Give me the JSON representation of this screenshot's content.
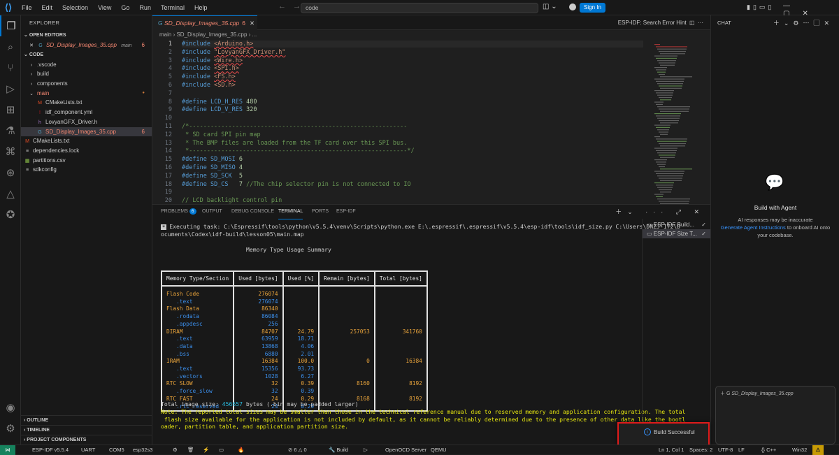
{
  "titlebar": {
    "menu": [
      "File",
      "Edit",
      "Selection",
      "View",
      "Go",
      "Run",
      "Terminal",
      "Help"
    ],
    "command_center": "code",
    "sign_in": "Sign In"
  },
  "sidebar": {
    "title": "EXPLORER",
    "open_editors_label": "OPEN EDITORS",
    "open_editor": {
      "name": "SD_Display_Images_35.cpp",
      "folder": "main",
      "count": "6"
    },
    "root_label": "CODE",
    "tree": [
      {
        "name": ".vscode",
        "kind": "folder",
        "icon": "›"
      },
      {
        "name": "build",
        "kind": "folder",
        "icon": "›"
      },
      {
        "name": "components",
        "kind": "folder",
        "icon": "›"
      },
      {
        "name": "main",
        "kind": "folder-open",
        "icon": "⌄"
      },
      {
        "name": "CMakeLists.txt",
        "kind": "file",
        "icon": "M"
      },
      {
        "name": "idf_component.yml",
        "kind": "file",
        "icon": "!"
      },
      {
        "name": "LovyanGFX_Driver.h",
        "kind": "file",
        "icon": "h"
      },
      {
        "name": "SD_Display_Images_35.cpp",
        "kind": "file",
        "icon": "G",
        "count": "6"
      },
      {
        "name": "CMakeLists.txt",
        "kind": "file",
        "icon": "M"
      },
      {
        "name": "dependencies.lock",
        "kind": "file",
        "icon": "≡"
      },
      {
        "name": "partitions.csv",
        "kind": "file",
        "icon": "▦"
      },
      {
        "name": "sdkconfig",
        "kind": "file",
        "icon": "≡"
      }
    ],
    "bottom_sections": [
      "OUTLINE",
      "TIMELINE",
      "PROJECT COMPONENTS"
    ]
  },
  "editor": {
    "tab_label": "SD_Display_Images_35.cpp",
    "tab_count": "6",
    "tab_right": "ESP-IDF: Search Error Hint",
    "breadcrumb": "main  ›  SD_Display_Images_35.cpp  ›  ...",
    "lines": [
      {
        "n": "1",
        "html": "<span class='kw'>#include</span> <span class='inc wav'>&lt;Arduino.h&gt;</span>"
      },
      {
        "n": "2",
        "html": "<span class='kw'>#include</span> <span class='inc wav'>\"LovyanGFX_Driver.h\"</span>"
      },
      {
        "n": "3",
        "html": "<span class='kw'>#include</span> <span class='inc wav'>&lt;Wire.h&gt;</span>"
      },
      {
        "n": "4",
        "html": "<span class='kw'>#include</span> <span class='inc wav'>&lt;SPI.h&gt;</span>"
      },
      {
        "n": "5",
        "html": "<span class='kw'>#include</span> <span class='inc wav'>&lt;FS.h&gt;</span>"
      },
      {
        "n": "6",
        "html": "<span class='kw'>#include</span> <span class='inc'>&lt;SD.h&gt;</span>"
      },
      {
        "n": "7",
        "html": ""
      },
      {
        "n": "8",
        "html": "<span class='kw'>#define</span> <span class='mac'>LCD_H_RES</span> <span class='num'>480</span>"
      },
      {
        "n": "9",
        "html": "<span class='kw'>#define</span> <span class='mac'>LCD_V_RES</span> <span class='num'>320</span>"
      },
      {
        "n": "10",
        "html": ""
      },
      {
        "n": "11",
        "html": "<span class='cm'>/*-------------------------------------------------------------</span>"
      },
      {
        "n": "12",
        "html": "<span class='cm'> * SD card SPI pin map</span>"
      },
      {
        "n": "13",
        "html": "<span class='cm'> * The BMP files are loaded from the TF card over this SPI bus.</span>"
      },
      {
        "n": "14",
        "html": "<span class='cm'> *-------------------------------------------------------------*/</span>"
      },
      {
        "n": "15",
        "html": "<span class='kw'>#define</span> <span class='mac'>SD_MOSI</span> <span class='num'>6</span>"
      },
      {
        "n": "16",
        "html": "<span class='kw'>#define</span> <span class='mac'>SD_MISO</span> <span class='num'>4</span>"
      },
      {
        "n": "17",
        "html": "<span class='kw'>#define</span> <span class='mac'>SD_SCK</span>  <span class='num'>5</span>"
      },
      {
        "n": "18",
        "html": "<span class='kw'>#define</span> <span class='mac'>SD_CS</span>   <span class='num'>7</span> <span class='cm'>//The chip selector pin is not connected to IO</span>"
      },
      {
        "n": "19",
        "html": ""
      },
      {
        "n": "20",
        "html": "<span class='cm'>// LCD backlight control pin</span>"
      }
    ]
  },
  "panel": {
    "tabs": [
      {
        "label": "PROBLEMS",
        "badge": "6"
      },
      {
        "label": "OUTPUT"
      },
      {
        "label": "DEBUG CONSOLE"
      },
      {
        "label": "TERMINAL",
        "active": true
      },
      {
        "label": "PORTS"
      },
      {
        "label": "ESP-IDF"
      }
    ],
    "terminal": {
      "task_line1": "Executing task: C:\\Espressif\\tools\\python\\v5.5.4\\venv\\Scripts\\python.exe E:\\.espressif\\.espressif\\v5.5.4\\esp-idf\\tools\\idf_size.py C:\\Users\\DNZJ-172\\D",
      "task_line2": "ocuments\\Codex\\idf-build\\lesson05\\main.map",
      "table_title": "Memory Type Usage Summary",
      "headers": [
        "Memory Type/Section",
        "Used [bytes]",
        "Used [%]",
        "Remain [bytes]",
        "Total [bytes]"
      ],
      "rows": [
        {
          "name": "Flash Code",
          "used": "276074",
          "pct": "",
          "remain": "",
          "total": "",
          "sub": false
        },
        {
          "name": "   .text",
          "used": "276074",
          "pct": "",
          "remain": "",
          "total": "",
          "sub": true
        },
        {
          "name": "Flash Data",
          "used": "86340",
          "pct": "",
          "remain": "",
          "total": "",
          "sub": false
        },
        {
          "name": "   .rodata",
          "used": "86084",
          "pct": "",
          "remain": "",
          "total": "",
          "sub": true
        },
        {
          "name": "   .appdesc",
          "used": "256",
          "pct": "",
          "remain": "",
          "total": "",
          "sub": true
        },
        {
          "name": "DIRAM",
          "used": "84707",
          "pct": "24.79",
          "remain": "257053",
          "total": "341760",
          "sub": false
        },
        {
          "name": "   .text",
          "used": "63959",
          "pct": "18.71",
          "remain": "",
          "total": "",
          "sub": true
        },
        {
          "name": "   .data",
          "used": "13868",
          "pct": "4.06",
          "remain": "",
          "total": "",
          "sub": true
        },
        {
          "name": "   .bss",
          "used": "6880",
          "pct": "2.01",
          "remain": "",
          "total": "",
          "sub": true
        },
        {
          "name": "IRAM",
          "used": "16384",
          "pct": "100.0",
          "remain": "0",
          "total": "16384",
          "sub": false
        },
        {
          "name": "   .text",
          "used": "15356",
          "pct": "93.73",
          "remain": "",
          "total": "",
          "sub": true
        },
        {
          "name": "   .vectors",
          "used": "1028",
          "pct": "6.27",
          "remain": "",
          "total": "",
          "sub": true
        },
        {
          "name": "RTC SLOW",
          "used": "32",
          "pct": "0.39",
          "remain": "8160",
          "total": "8192",
          "sub": false
        },
        {
          "name": "   .force_slow",
          "used": "32",
          "pct": "0.39",
          "remain": "",
          "total": "",
          "sub": true
        },
        {
          "name": "RTC FAST",
          "used": "24",
          "pct": "0.29",
          "remain": "8168",
          "total": "8192",
          "sub": false
        },
        {
          "name": "   .rtc_reserved",
          "used": "24",
          "pct": "0.29",
          "remain": "",
          "total": "",
          "sub": true
        }
      ],
      "total_prefix": "Total image size: ",
      "total_value": "456657",
      "total_suffix": " bytes (.bin may be padded larger)",
      "note_lines": [
        "Note: The reported total sizes may be smaller than those in the technical reference manual due to reserved memory and application configuration. The total",
        " flash size available for the application is not included by default, as it cannot be reliably determined due to the presence of other data like the bootl",
        "oader, partition table, and application partition size."
      ]
    },
    "terminal_list": [
      "ESP-IDF Build...",
      "ESP-IDF Size T..."
    ]
  },
  "chat": {
    "title": "CHAT",
    "agent_title": "Build with Agent",
    "agent_desc_1": "AI responses may be inaccurate",
    "agent_link": "Generate Agent Instructions",
    "agent_desc_2": " to onboard AI onto your codebase.",
    "context_file": "SD_Display_Images_35.cpp"
  },
  "toast": {
    "message": "Build Successful"
  },
  "statusbar": {
    "left": [
      "ESP-IDF v5.5.4",
      "UART",
      "COM5",
      "esp32s3",
      "⚙",
      "🗑",
      "⚡",
      "▭",
      "🔥",
      "⊘ 6 △ 0",
      "🔧 Build",
      "▷",
      "OpenOCD Server",
      "QEMU"
    ],
    "right": [
      "Ln 1, Col 1",
      "Spaces: 2",
      "UTF-8",
      "LF",
      "{} C++",
      "Win32"
    ],
    "warn_icon": "⚠"
  },
  "colors": {
    "accent": "#0078d4",
    "toast_border": "#e01b1b",
    "error": "#f48771"
  }
}
